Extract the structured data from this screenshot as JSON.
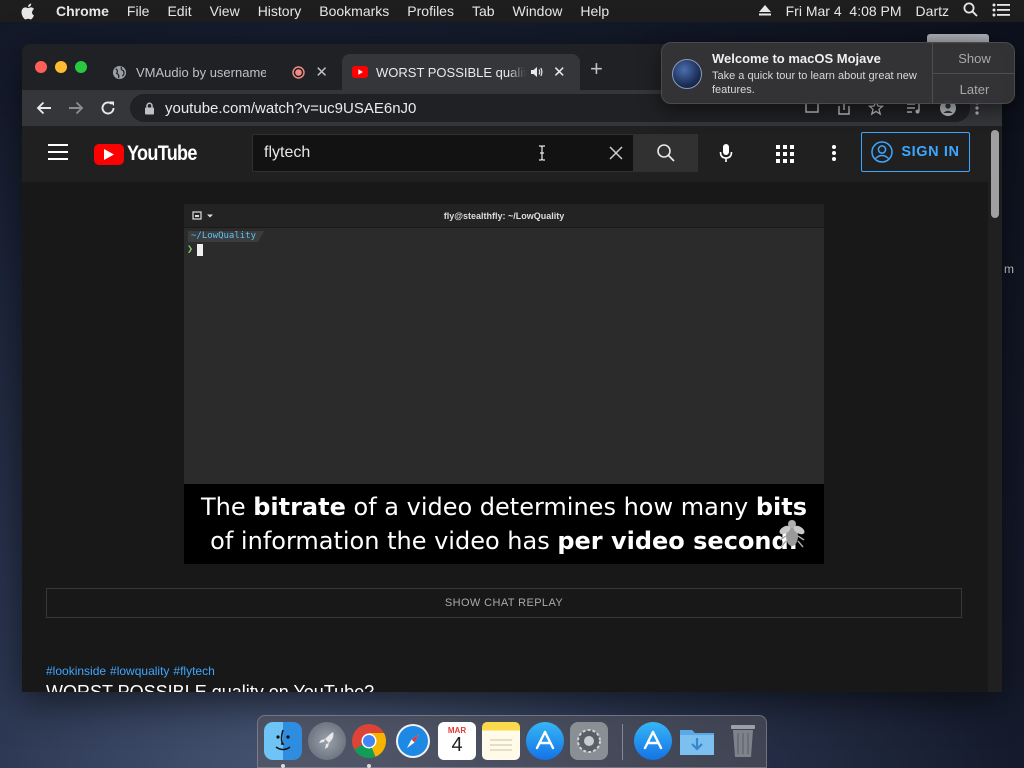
{
  "menubar": {
    "app_name": "Chrome",
    "items": [
      "File",
      "Edit",
      "View",
      "History",
      "Bookmarks",
      "Profiles",
      "Tab",
      "Window",
      "Help"
    ],
    "datetime": "Fri Mar 4  4:08 PM",
    "user": "Dartz"
  },
  "browser": {
    "tabs": [
      {
        "title": "VMAudio by usernamee",
        "icon": "globe-icon"
      },
      {
        "title": "WORST POSSIBLE quality o",
        "icon": "youtube-icon"
      }
    ],
    "url": "youtube.com/watch?v=uc9USAE6nJ0"
  },
  "youtube": {
    "logo_text": "YouTube",
    "search_query": "flytech",
    "signin_label": "SIGN IN",
    "chat_replay_label": "SHOW CHAT REPLAY",
    "hashtags": [
      "#lookinside",
      "#lowquality",
      "#flytech"
    ],
    "video_title": "WORST POSSIBLE quality on YouTube?"
  },
  "video": {
    "terminal_title": "fly@stealthfly: ~/LowQuality",
    "terminal_path": "~/LowQuality",
    "terminal_prompt": "❯",
    "caption": {
      "line1": [
        {
          "text": "The ",
          "bold": false
        },
        {
          "text": "bitrate",
          "bold": true
        },
        {
          "text": " of a video determines how many ",
          "bold": false
        },
        {
          "text": "bits",
          "bold": true
        }
      ],
      "line2": [
        {
          "text": "of information the video has ",
          "bold": false
        },
        {
          "text": "per video second.",
          "bold": true
        }
      ]
    }
  },
  "notification": {
    "title": "Welcome to macOS Mojave",
    "body": "Take a quick tour to learn about great new features.",
    "show_label": "Show",
    "later_label": "Later"
  },
  "dock": {
    "apps": [
      "finder-icon",
      "launchpad-icon",
      "chrome-icon",
      "safari-icon",
      "calendar-icon",
      "notes-icon",
      "app-store-icon",
      "system-preferences-icon",
      "app-store-icon",
      "downloads-folder-icon",
      "trash-icon"
    ],
    "calendar_month": "MAR",
    "calendar_day": "4"
  },
  "edge_text": "m",
  "colors": {
    "yt_red": "#ff0000",
    "yt_blue": "#3ea6ff",
    "terminal_path": "#5fc0e8",
    "prompt_green": "#7fd36b"
  }
}
